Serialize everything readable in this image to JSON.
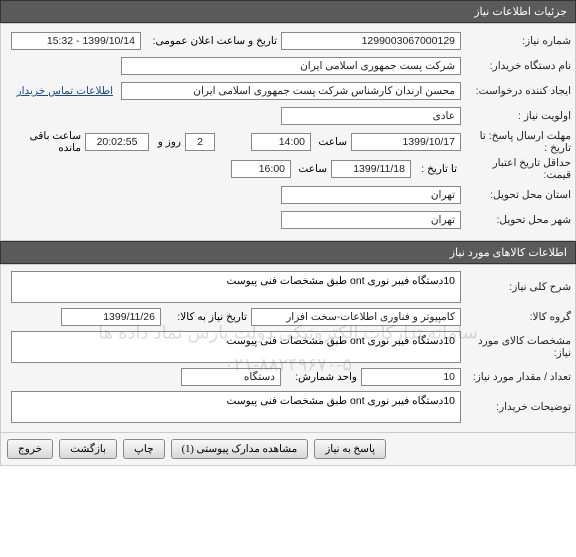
{
  "section1": {
    "title": "جزئیات اطلاعات نیاز",
    "need_no_label": "شماره نیاز:",
    "need_no": "1299003067000129",
    "announce_label": "تاریخ و ساعت اعلان عمومی:",
    "announce_value": "1399/10/14 - 15:32",
    "buyer_label": "نام دستگاه خریدار:",
    "buyer": "شرکت پست جمهوری اسلامی ایران",
    "creator_label": "ایجاد کننده درخواست:",
    "creator": "محسن ارندان کارشناس شرکت پست جمهوری اسلامی ایران",
    "contact_link": "اطلاعات تماس خریدار",
    "priority_label": "اولویت نیاز :",
    "priority": "عادی",
    "deadline_label": "مهلت ارسال پاسخ:",
    "to_date_label": "تا تاریخ :",
    "deadline_date": "1399/10/17",
    "time_label": "ساعت",
    "deadline_time": "14:00",
    "day_label": "روز و",
    "days_left": "2",
    "remain_label": "ساعت باقی مانده",
    "remain_time": "20:02:55",
    "min_credit_label": "حداقل تاریخ اعتبار قیمت:",
    "min_credit_date": "1399/11/18",
    "min_credit_time": "16:00",
    "province_label": "استان محل تحویل:",
    "province": "تهران",
    "city_label": "شهر محل تحویل:",
    "city": "تهران"
  },
  "section2": {
    "title": "اطلاعات کالاهای مورد نیاز",
    "desc_label": "شرح کلی نیاز:",
    "desc": "10دستگاه فیبر نوری ont طبق مشخصات فنی پیوست",
    "group_label": "گروه کالا:",
    "group": "کامپیوتر و فناوری اطلاعات-سخت افزار",
    "need_date_label": "تاریخ نیاز به کالا:",
    "need_date": "1399/11/26",
    "spec_label": "مشخصات کالای مورد نیاز:",
    "spec": "10دستگاه فیبر نوری ont طبق مشخصات فنی پیوست",
    "qty_label": "تعداد / مقدار مورد نیاز:",
    "qty": "10",
    "unit_label": "واحد شمارش:",
    "unit": "دستگاه",
    "buyer_notes_label": "توضیحات خریدار:",
    "buyer_notes": "10دستگاه فیبر نوری ont طبق مشخصات فنی پیوست"
  },
  "watermark": {
    "line1": "سامانه تدارکات الکترونیکی دولت پارس نماد داده ها",
    "line2": "۰۲۱-۸۸۲۴۹۶۷۰-۵"
  },
  "footer": {
    "reply": "پاسخ به نیاز",
    "attach": "مشاهده مدارک پیوستی (1)",
    "print": "چاپ",
    "back": "بازگشت",
    "exit": "خروج"
  }
}
